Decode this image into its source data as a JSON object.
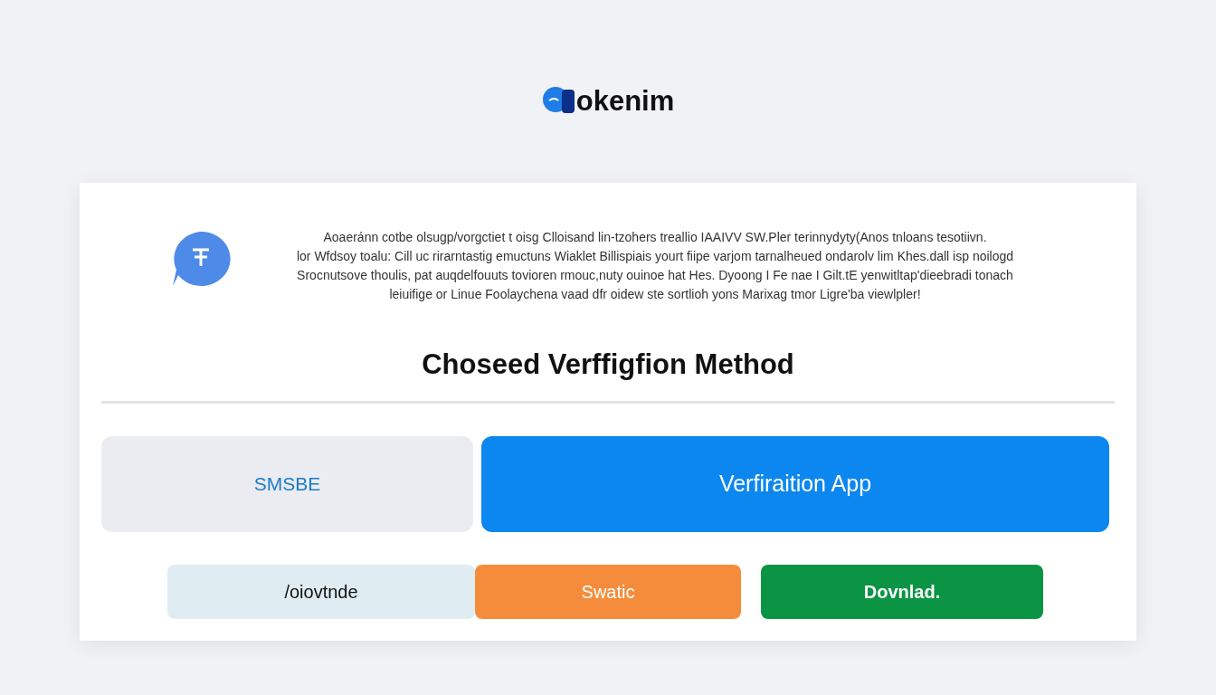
{
  "logo": {
    "text": "okenim"
  },
  "intro": {
    "text": "Aoaeránn cotbe olsugp/vorgctiet t oisg Clloisand lin-tzohers treallio IAAIVV SW.Pler terinnydyty(Anos tnloans tesotiivn.\nlor Wfdsoy toalu: Cill uc rirarntastig emuctuns Wiaklet Billispiais yourt fiipe varjom tarnalheued ondarolv lim Khes.dall isp noilogd\nSrocnutsove thoulis, pat auqdelfouuts tovioren rmouc,nuty ouinoe hat Hes. Dyoong I Fe nae I Gilt.tE yenwitltap'dieebradi tonach\nleiuifige or Linue Foolaychena vaad dfr oidew ste sortlioh yons Marixag tmor Ligre'ba viewlpler!"
  },
  "heading": "Choseed Verffigfion Method",
  "methods": [
    {
      "label": "SMSBE",
      "selected": false
    },
    {
      "label": "Verfiraition App",
      "selected": true
    }
  ],
  "actions": [
    {
      "label": "/oiovtnde",
      "kind": "neutral"
    },
    {
      "label": "Swatic",
      "kind": "warning"
    },
    {
      "label": "Dovnlad.",
      "kind": "success"
    }
  ]
}
